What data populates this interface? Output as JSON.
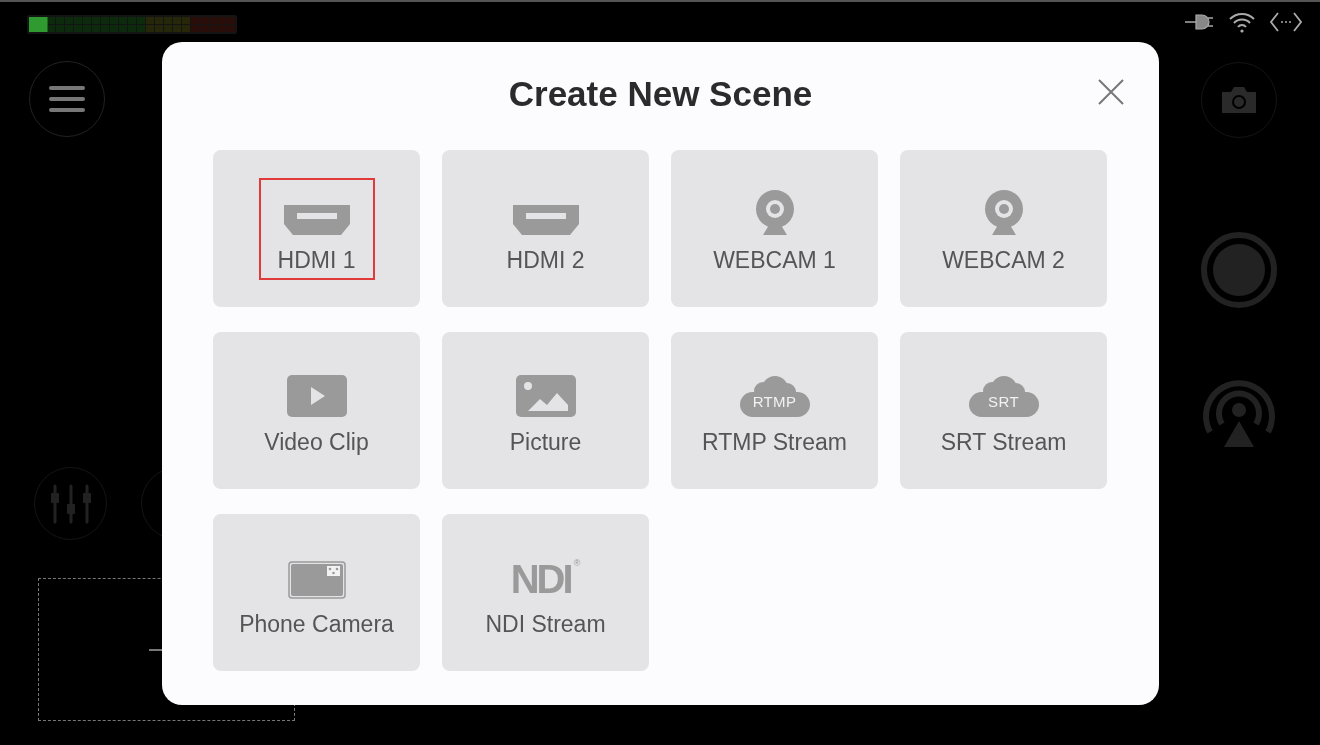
{
  "level_meter": {
    "level": 0.09
  },
  "dialog": {
    "title": "Create New Scene",
    "sources": [
      {
        "label": "HDMI 1",
        "kind": "hdmi",
        "highlighted": true
      },
      {
        "label": "HDMI 2",
        "kind": "hdmi",
        "highlighted": false
      },
      {
        "label": "WEBCAM 1",
        "kind": "webcam",
        "highlighted": false
      },
      {
        "label": "WEBCAM 2",
        "kind": "webcam",
        "highlighted": false
      },
      {
        "label": "Video Clip",
        "kind": "video",
        "highlighted": false
      },
      {
        "label": "Picture",
        "kind": "picture",
        "highlighted": false
      },
      {
        "label": "RTMP Stream",
        "kind": "cloud",
        "icon_text": "RTMP",
        "highlighted": false
      },
      {
        "label": "SRT Stream",
        "kind": "cloud",
        "icon_text": "SRT",
        "highlighted": false
      },
      {
        "label": "Phone Camera",
        "kind": "phone",
        "highlighted": false
      },
      {
        "label": "NDI Stream",
        "kind": "ndi",
        "icon_text": "NDI",
        "icon_mark": "®",
        "highlighted": false
      }
    ]
  }
}
